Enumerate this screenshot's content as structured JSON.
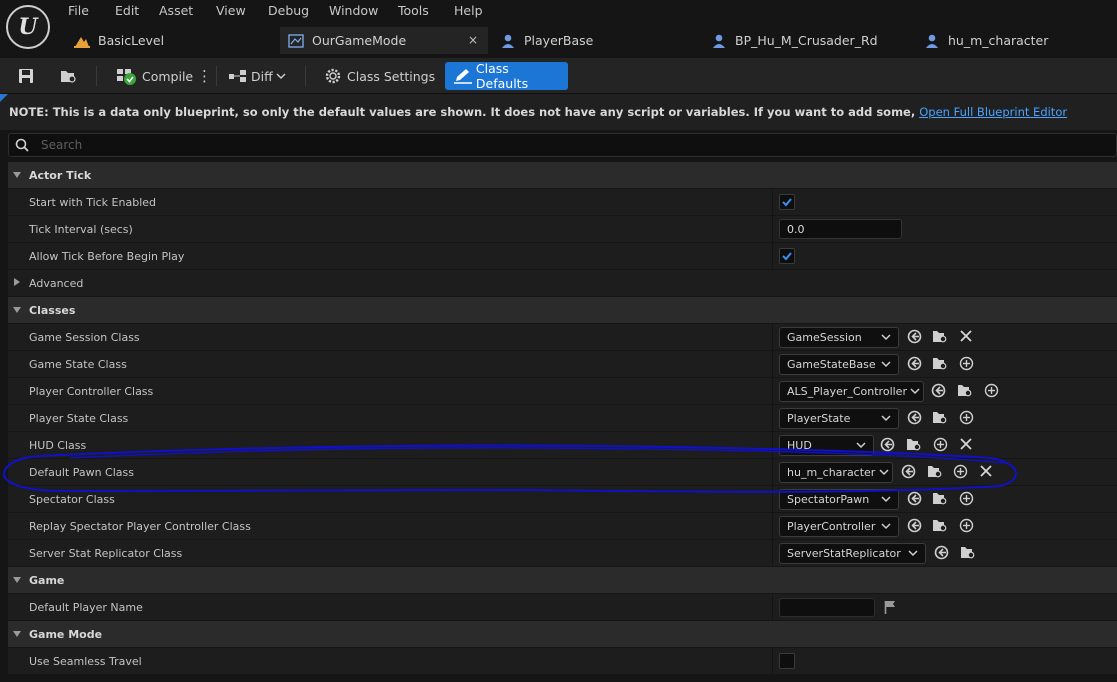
{
  "menu": [
    "File",
    "Edit",
    "Asset",
    "View",
    "Debug",
    "Window",
    "Tools",
    "Help"
  ],
  "tabs": [
    {
      "label": "BasicLevel",
      "icon": "level-icon"
    },
    {
      "label": "OurGameMode",
      "icon": "blueprint-icon",
      "close": "×"
    },
    {
      "label": "PlayerBase",
      "icon": "character-icon"
    },
    {
      "label": "BP_Hu_M_Crusader_Rd",
      "icon": "character-icon"
    },
    {
      "label": "hu_m_character",
      "icon": "character-icon"
    }
  ],
  "toolbar": {
    "compile": "Compile",
    "compile_more": "⋮",
    "diff": "Diff",
    "class_settings": "Class Settings",
    "class_defaults": "Class Defaults"
  },
  "note": {
    "text": "NOTE: This is a data only blueprint, so only the default values are shown.  It does not have any script or variables.  If you want to add some,",
    "link": "Open Full Blueprint Editor"
  },
  "search": {
    "placeholder": "Search"
  },
  "details": {
    "actor_tick": {
      "title": "Actor Tick",
      "start_with_tick": {
        "label": "Start with Tick Enabled",
        "checked": true
      },
      "tick_interval": {
        "label": "Tick Interval (secs)",
        "value": "0.0"
      },
      "allow_tick": {
        "label": "Allow Tick Before Begin Play",
        "checked": true
      },
      "advanced": "Advanced"
    },
    "classes": {
      "title": "Classes",
      "game_session": {
        "label": "Game Session Class",
        "value": "GameSession"
      },
      "game_state": {
        "label": "Game State Class",
        "value": "GameStateBase"
      },
      "player_controller": {
        "label": "Player Controller Class",
        "value": "ALS_Player_Controller"
      },
      "player_state": {
        "label": "Player State Class",
        "value": "PlayerState"
      },
      "hud": {
        "label": "HUD Class",
        "value": "HUD"
      },
      "default_pawn": {
        "label": "Default Pawn Class",
        "value": "hu_m_character"
      },
      "spectator": {
        "label": "Spectator Class",
        "value": "SpectatorPawn"
      },
      "replay_spectator": {
        "label": "Replay Spectator Player Controller Class",
        "value": "PlayerController"
      },
      "server_stat": {
        "label": "Server Stat Replicator Class",
        "value": "ServerStatReplicator"
      }
    },
    "game": {
      "title": "Game",
      "default_player_name": {
        "label": "Default Player Name",
        "value": ""
      }
    },
    "game_mode": {
      "title": "Game Mode",
      "seamless_travel": {
        "label": "Use Seamless Travel",
        "checked": false
      }
    }
  },
  "colors": {
    "accent": "#1c76d6",
    "link": "#4aa3ff",
    "annotation": "#1010c8",
    "check": "#3b8ff0"
  }
}
